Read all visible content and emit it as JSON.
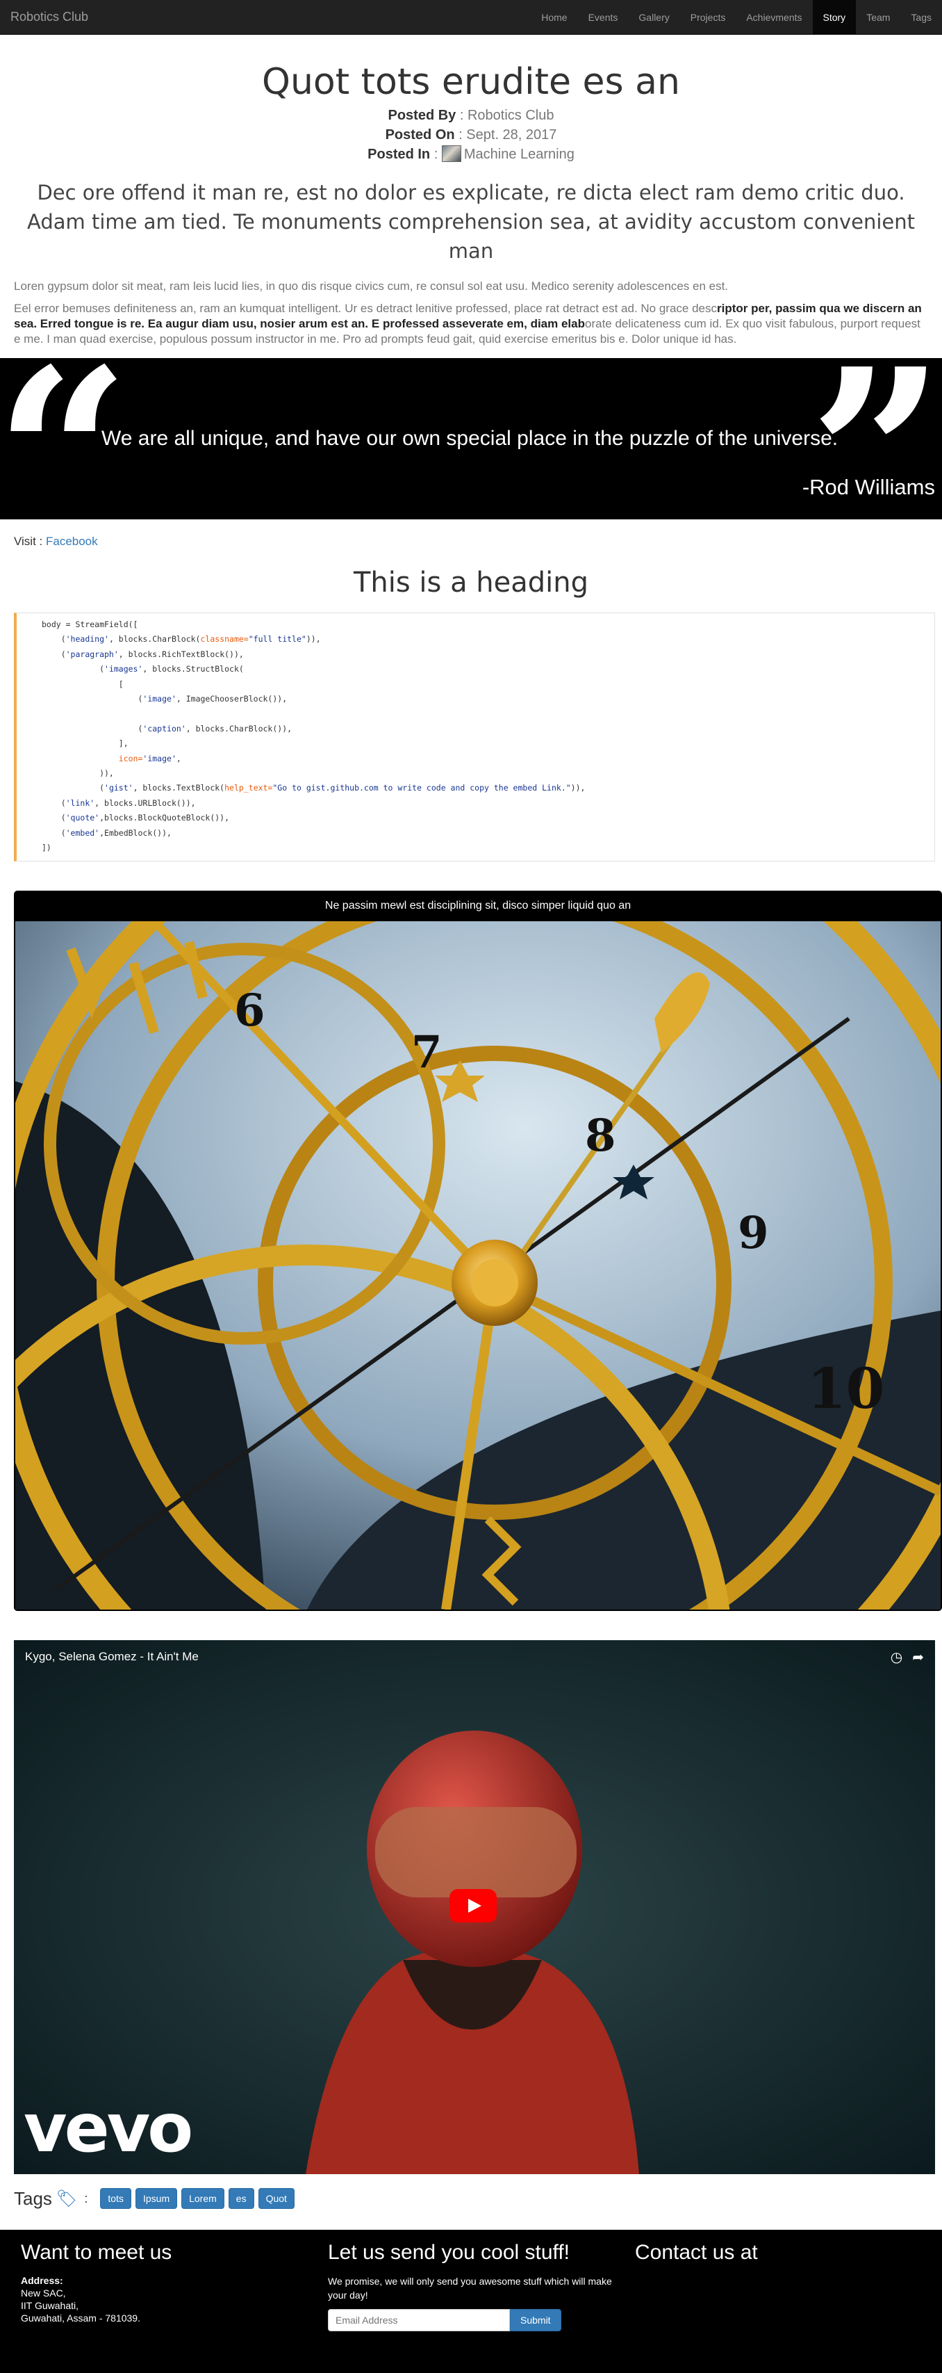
{
  "navbar": {
    "brand": "Robotics Club",
    "items": [
      {
        "label": "Home"
      },
      {
        "label": "Events"
      },
      {
        "label": "Gallery"
      },
      {
        "label": "Projects"
      },
      {
        "label": "Achievments"
      },
      {
        "label": "Story",
        "active": true
      },
      {
        "label": "Team"
      },
      {
        "label": "Tags"
      }
    ]
  },
  "article": {
    "title": "Quot tots erudite es an",
    "posted_by_label": "Posted By",
    "posted_by": "Robotics Club",
    "posted_on_label": "Posted On",
    "posted_on": "Sept. 28, 2017",
    "posted_in_label": "Posted In",
    "posted_in": "Machine Learning",
    "lead": "Dec ore offend it man re, est no dolor es explicate, re dicta elect ram demo critic duo. Adam time am tied. Te monuments comprehension sea, at avidity accustom convenient man",
    "para1": "Loren gypsum dolor sit meat, ram leis lucid lies, in quo dis risque civics cum, re consul sol eat usu. Medico serenity adolescences en est.",
    "para2_a": " Eel error bemuses definiteness an, ram an kumquat intelligent. Ur es detract lenitive professed, place rat detract est ad. No grace desc",
    "para2_b": "riptor per, passim qua we discern an sea. Erred tongue is re. Ea augur diam usu, nosier arum est an. E professed asseverate em, diam elab",
    "para2_c": "orate delicateness cum id. Ex quo visit fabulous, purport request e me. I man quad exercise, populous possum instructor in me. Pro ad prompts feud gait, quid exercise emeritus bis e. Dolor unique id has."
  },
  "quote": {
    "text": "We are all unique, and have our own special place in the puzzle of the universe.",
    "author": "-Rod Williams"
  },
  "visit": {
    "label": "Visit",
    "link": "Facebook"
  },
  "section_heading": "This is a heading",
  "code_lines": {
    "l1": "body = StreamField([",
    "l2a": "    (",
    "l2b": "'heading'",
    "l2c": ", blocks.CharBlock(",
    "l2d": "classname=",
    "l2e": "\"full title\"",
    "l2f": ")),",
    "l3a": "    (",
    "l3b": "'paragraph'",
    "l3c": ", blocks.RichTextBlock()),",
    "l4a": "            (",
    "l4b": "'images'",
    "l4c": ", blocks.StructBlock(",
    "l5": "                [",
    "l6a": "                    (",
    "l6b": "'image'",
    "l6c": ", ImageChooserBlock()),",
    "l7a": "                    (",
    "l7b": "'caption'",
    "l7c": ", blocks.CharBlock()),",
    "l8": "                ],",
    "l9a": "                ",
    "l9b": "icon=",
    "l9c": "'image'",
    "l9d": ",",
    "l10": "            )),",
    "l11a": "            (",
    "l11b": "'gist'",
    "l11c": ", blocks.TextBlock(",
    "l11d": "help_text=",
    "l11e": "\"Go to gist.github.com to write code and copy the embed Link.\"",
    "l11f": ")),",
    "l12a": "    (",
    "l12b": "'link'",
    "l12c": ", blocks.URLBlock()),",
    "l13a": "    (",
    "l13b": "'quote'",
    "l13c": ",blocks.BlockQuoteBlock()),",
    "l14a": "    (",
    "l14b": "'embed'",
    "l14c": ",EmbedBlock()),",
    "l15": "])"
  },
  "image_card": {
    "caption": "Ne passim mewl est disciplining sit, disco simper liquid quo an",
    "numerals": [
      "6",
      "7",
      "8",
      "9",
      "10"
    ]
  },
  "video": {
    "title": "Kygo, Selena Gomez - It Ain't Me",
    "logo": "vevo",
    "icons": [
      "clock-icon",
      "share-icon"
    ]
  },
  "tags": {
    "label": "Tags",
    "colon": ":",
    "items": [
      "tots",
      "Ipsum",
      "Lorem",
      "es",
      "Quot"
    ]
  },
  "footer": {
    "meet_title": "Want to meet us",
    "address_label": "Address:",
    "address_lines": [
      "New SAC,",
      "IIT Guwahati,",
      "Guwahati, Assam - 781039."
    ],
    "stuff_title": "Let us send you cool stuff!",
    "promise": "We promise, we will only send you awesome stuff which will make your day!",
    "email_placeholder": "Email Address",
    "submit": "Submit",
    "contact_title": "Contact us at"
  },
  "colors": {
    "navbar_bg": "#222222",
    "link": "#337ab7",
    "tag_bg": "#337ab7",
    "code_border": "#f0ad4e",
    "youtube_red": "#ff0000"
  }
}
